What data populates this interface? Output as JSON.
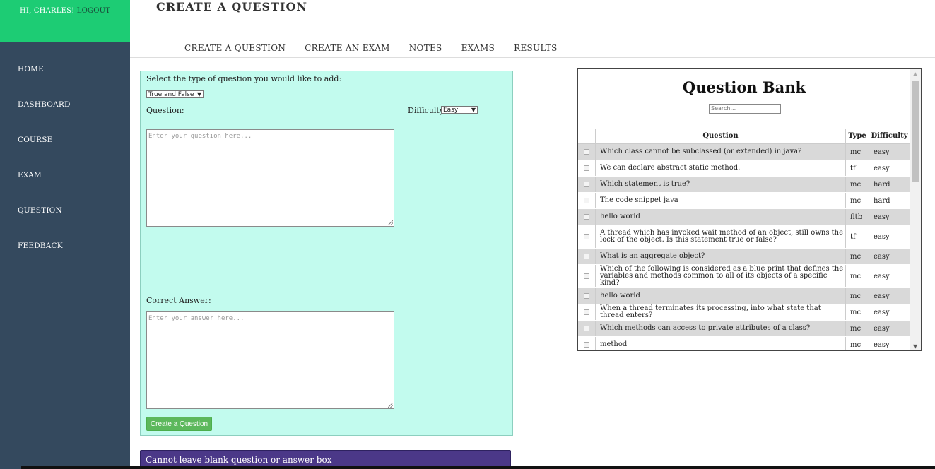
{
  "sidebar": {
    "greeting": "HI, CHARLES!",
    "logout": "LOGOUT",
    "items": [
      {
        "label": "HOME"
      },
      {
        "label": "DASHBOARD"
      },
      {
        "label": "COURSE"
      },
      {
        "label": "EXAM"
      },
      {
        "label": "QUESTION"
      },
      {
        "label": "FEEDBACK"
      }
    ]
  },
  "header": {
    "title": "CREATE A QUESTION",
    "nav": [
      {
        "label": "CREATE A QUESTION"
      },
      {
        "label": "CREATE AN EXAM"
      },
      {
        "label": "NOTES"
      },
      {
        "label": "EXAMS"
      },
      {
        "label": "RESULTS"
      }
    ]
  },
  "form": {
    "type_prompt": "Select the type of question you would like to add:",
    "type_value": "True and False",
    "question_label": "Question:",
    "difficulty_label": "Difficulty:",
    "difficulty_value": "Easy",
    "question_placeholder": "Enter your question here...",
    "answer_label": "Correct Answer:",
    "answer_placeholder": "Enter your answer here...",
    "submit_label": "Create a Question"
  },
  "error": {
    "message": "Cannot leave blank question or answer box"
  },
  "question_bank": {
    "title": "Question Bank",
    "search_placeholder": "Search...",
    "columns": {
      "question": "Question",
      "type": "Type",
      "difficulty": "Difficulty"
    },
    "rows": [
      {
        "question": "Which class cannot be subclassed (or extended) in java?",
        "type": "mc",
        "difficulty": "easy"
      },
      {
        "question": "We can declare abstract static method.",
        "type": "tf",
        "difficulty": "easy"
      },
      {
        "question": "Which statement is true?",
        "type": "mc",
        "difficulty": "hard"
      },
      {
        "question": "The code snippet java",
        "type": "mc",
        "difficulty": "hard"
      },
      {
        "question": "hello world",
        "type": "fitb",
        "difficulty": "easy"
      },
      {
        "question": "A thread which has invoked wait method of an object, still owns the lock of the object. Is this statement true or false?",
        "type": "tf",
        "difficulty": "easy"
      },
      {
        "question": "What is an aggregate object?",
        "type": "mc",
        "difficulty": "easy"
      },
      {
        "question": "Which of the following is considered as a blue print that defines the variables and methods common to all of its objects of a specific kind?",
        "type": "mc",
        "difficulty": "easy"
      },
      {
        "question": "hello world",
        "type": "mc",
        "difficulty": "easy"
      },
      {
        "question": "When a thread terminates its processing, into what state that thread enters?",
        "type": "mc",
        "difficulty": "easy"
      },
      {
        "question": "Which methods can access to private attributes of a class?",
        "type": "mc",
        "difficulty": "easy"
      },
      {
        "question": "method",
        "type": "mc",
        "difficulty": "easy"
      }
    ]
  },
  "colors": {
    "sidebar_bg": "#34495e",
    "sidebar_top": "#1dcc74",
    "form_bg": "#c2fbee",
    "button_green": "#5cb85c",
    "error_bg": "#4b3888",
    "row_alt": "#d9d9d9"
  }
}
